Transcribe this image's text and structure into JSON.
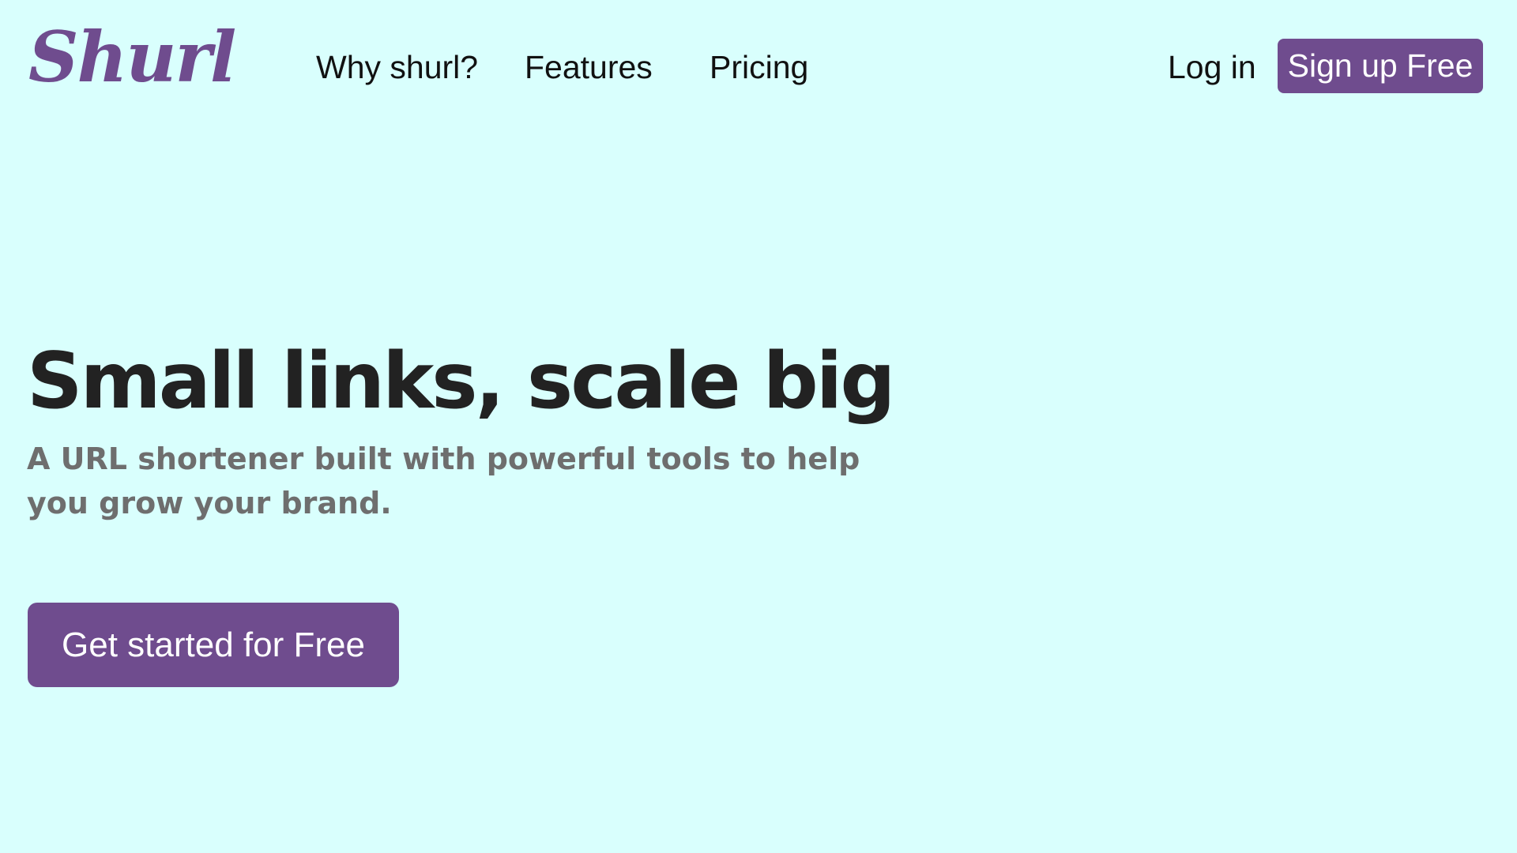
{
  "brand": {
    "logo_text": "Shurl",
    "accent_color": "#6f4c8e",
    "background_color": "#d9fffd"
  },
  "nav": {
    "items": [
      {
        "label": "Why shurl?"
      },
      {
        "label": "Features"
      },
      {
        "label": "Pricing"
      }
    ],
    "login_label": "Log in",
    "signup_label": "Sign up Free"
  },
  "hero": {
    "title": "Small links, scale big",
    "subtitle": "A URL shortener built with powerful tools to help you grow your brand.",
    "cta_label": "Get started for Free"
  }
}
